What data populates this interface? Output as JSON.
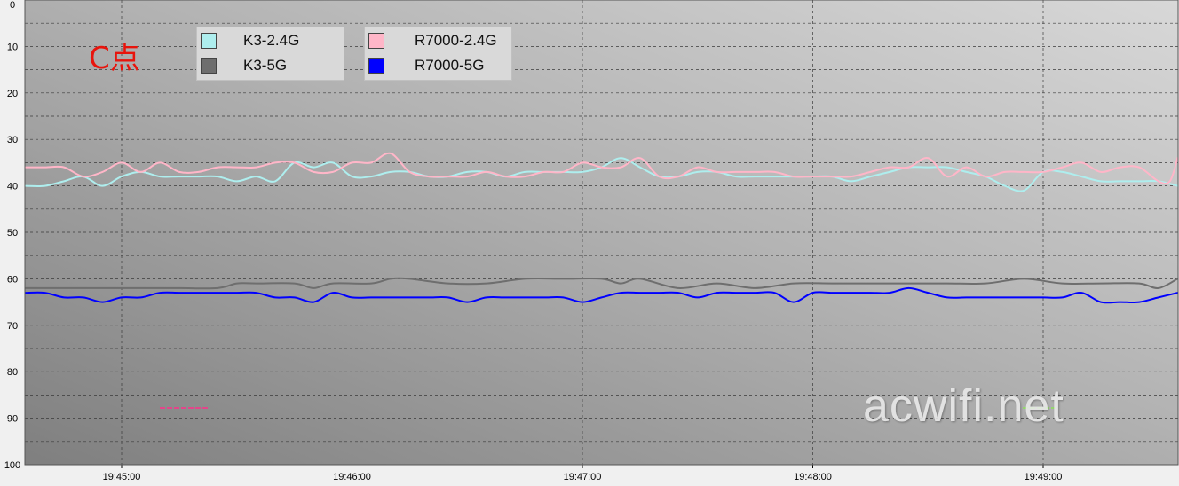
{
  "corner_label": "C点",
  "watermark": "acwifi.net",
  "legend": [
    {
      "name": "K3-2.4G",
      "color": "#aeeeee"
    },
    {
      "name": "K3-5G",
      "color": "#6e6e6e"
    },
    {
      "name": "R7000-2.4G",
      "color": "#ffb6c8"
    },
    {
      "name": "R7000-5G",
      "color": "#0000ff"
    }
  ],
  "chart_data": {
    "type": "line",
    "title": "",
    "xlabel": "",
    "ylabel": "",
    "ylim": [
      0,
      100
    ],
    "y_inverted": true,
    "yticks": [
      "0",
      "10",
      "20",
      "30",
      "40",
      "50",
      "60",
      "70",
      "80",
      "90",
      "100"
    ],
    "xticks": [
      "19:45:00",
      "19:46:00",
      "19:47:00",
      "19:48:00",
      "19:49:00"
    ],
    "x_unit": "seconds since 19:44:35",
    "grid": true,
    "legend_position": "top-left",
    "series": [
      {
        "name": "K3-2.4G",
        "color": "#aeeeee",
        "x": [
          0,
          5,
          10,
          15,
          20,
          25,
          30,
          35,
          40,
          45,
          50,
          55,
          60,
          65,
          70,
          75,
          80,
          85,
          90,
          95,
          100,
          105,
          110,
          115,
          120,
          125,
          130,
          135,
          140,
          145,
          150,
          155,
          160,
          165,
          170,
          175,
          180,
          185,
          190,
          195,
          200,
          205,
          210,
          215,
          220,
          225,
          230,
          235,
          240,
          245,
          250,
          255,
          260,
          265,
          270,
          275,
          280,
          285,
          290,
          295,
          300
        ],
        "y": [
          40,
          40,
          39,
          38,
          40,
          38,
          37,
          38,
          38,
          38,
          38,
          39,
          38,
          39,
          35,
          36,
          35,
          38,
          38,
          37,
          37,
          38,
          38,
          37,
          37,
          38,
          37,
          37,
          37,
          37,
          36,
          34,
          36,
          38,
          38,
          37,
          37,
          38,
          38,
          38,
          38,
          38,
          38,
          39,
          38,
          37,
          36,
          36,
          36,
          37,
          38,
          40,
          41,
          37,
          37,
          38,
          39,
          39,
          39,
          39,
          40
        ]
      },
      {
        "name": "K3-5G",
        "color": "#6e6e6e",
        "x": [
          0,
          10,
          20,
          30,
          40,
          50,
          55,
          60,
          70,
          75,
          80,
          90,
          95,
          100,
          110,
          120,
          130,
          140,
          150,
          155,
          160,
          170,
          180,
          190,
          200,
          210,
          220,
          230,
          240,
          250,
          260,
          270,
          280,
          290,
          295,
          300
        ],
        "y": [
          62,
          62,
          62,
          62,
          62,
          62,
          61,
          61,
          61,
          62,
          61,
          61,
          60,
          60,
          61,
          61,
          60,
          60,
          60,
          61,
          60,
          62,
          61,
          62,
          61,
          61,
          61,
          61,
          61,
          61,
          60,
          61,
          61,
          61,
          62,
          60
        ]
      },
      {
        "name": "R7000-2.4G",
        "color": "#ffb6c8",
        "x": [
          0,
          5,
          10,
          15,
          20,
          25,
          30,
          35,
          40,
          45,
          50,
          55,
          60,
          65,
          70,
          75,
          80,
          85,
          90,
          95,
          100,
          105,
          110,
          115,
          120,
          125,
          130,
          135,
          140,
          145,
          150,
          155,
          160,
          165,
          170,
          175,
          180,
          185,
          190,
          195,
          200,
          205,
          210,
          215,
          220,
          225,
          230,
          235,
          240,
          245,
          250,
          255,
          260,
          265,
          270,
          275,
          280,
          285,
          290,
          295,
          298,
          300
        ],
        "y": [
          36,
          36,
          36,
          38,
          37,
          35,
          37,
          35,
          37,
          37,
          36,
          36,
          36,
          35,
          35,
          37,
          37,
          35,
          35,
          33,
          37,
          38,
          38,
          38,
          37,
          38,
          38,
          37,
          37,
          35,
          36,
          36,
          34,
          38,
          38,
          36,
          37,
          37,
          37,
          37,
          38,
          38,
          38,
          38,
          37,
          36,
          36,
          34,
          38,
          36,
          38,
          37,
          37,
          37,
          36,
          35,
          37,
          36,
          36,
          39,
          39,
          34
        ]
      },
      {
        "name": "R7000-5G",
        "color": "#0000ff",
        "x": [
          0,
          5,
          10,
          15,
          20,
          25,
          30,
          35,
          40,
          45,
          50,
          55,
          60,
          65,
          70,
          75,
          80,
          85,
          90,
          95,
          100,
          105,
          110,
          115,
          120,
          125,
          130,
          135,
          140,
          145,
          150,
          155,
          160,
          165,
          170,
          175,
          180,
          185,
          190,
          195,
          200,
          205,
          210,
          215,
          220,
          225,
          230,
          235,
          240,
          245,
          250,
          255,
          260,
          265,
          270,
          275,
          280,
          285,
          290,
          295,
          300
        ],
        "y": [
          63,
          63,
          64,
          64,
          65,
          64,
          64,
          63,
          63,
          63,
          63,
          63,
          63,
          64,
          64,
          65,
          63,
          64,
          64,
          64,
          64,
          64,
          64,
          65,
          64,
          64,
          64,
          64,
          64,
          65,
          64,
          63,
          63,
          63,
          63,
          64,
          63,
          63,
          63,
          63,
          65,
          63,
          63,
          63,
          63,
          63,
          62,
          63,
          64,
          64,
          64,
          64,
          64,
          64,
          64,
          63,
          65,
          65,
          65,
          64,
          63
        ]
      }
    ]
  }
}
